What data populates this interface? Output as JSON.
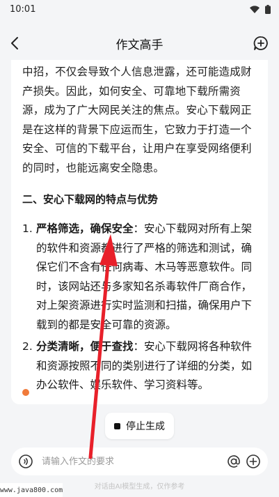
{
  "status": {
    "time": "10:01"
  },
  "nav": {
    "title": "作文高手"
  },
  "content": {
    "paragraph": "中招，不仅会导致个人信息泄露，还可能造成财产损失。因此，如何安全、可靠地下载所需资源，成为了广大网民关注的焦点。安心下载网正是在这样的背景下应运而生，它致力于打造一个安全、可信的下载平台，让用户在享受网络便利的同时，也能远离安全隐患。",
    "section_title": "二、安心下载网的特点与优势",
    "items": [
      {
        "num": "1.",
        "title": "严格筛选，确保安全",
        "text": "：安心下载网对所有上架的软件和资源都进行了严格的筛选和测试，确保它们不含有任何病毒、木马等恶意软件。同时，该网站还与多家知名杀毒软件厂商合作，对上架资源进行实时监测和扫描，确保用户下载到的都是安全可靠的资源。"
      },
      {
        "num": "2.",
        "title": "分类清晰，便于查找",
        "text": "：安心下载网将各种软件和资源按照不同的类别进行了详细的分类，如办公软件、娱乐软件、学习资料等。"
      }
    ]
  },
  "stop_button": {
    "label": "停止生成"
  },
  "input": {
    "placeholder": "请输入作文的要求"
  },
  "footer": {
    "note": "对话由AI模型生成，仅作参考"
  },
  "watermark": {
    "text": "www.java800.com"
  },
  "colors": {
    "loading_dot": "#f07a3a",
    "annotation_arrow": "#e8202a",
    "background": "#f4f5f7"
  }
}
